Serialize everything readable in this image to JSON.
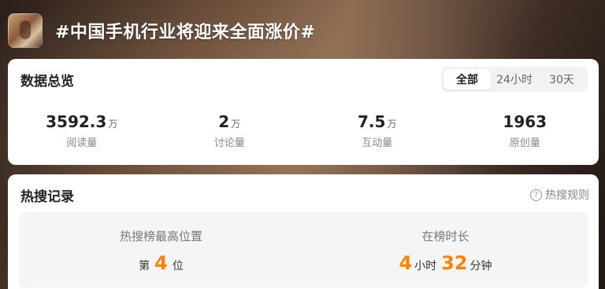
{
  "header": {
    "topic_title": "#中国手机行业将迎来全面涨价#"
  },
  "overview": {
    "title": "数据总览",
    "tabs": [
      {
        "label": "全部",
        "active": true
      },
      {
        "label": "24小时",
        "active": false
      },
      {
        "label": "30天",
        "active": false
      }
    ],
    "stats": [
      {
        "value": "3592.3",
        "unit": "万",
        "label": "阅读量"
      },
      {
        "value": "2",
        "unit": "万",
        "label": "讨论量"
      },
      {
        "value": "7.5",
        "unit": "万",
        "label": "互动量"
      },
      {
        "value": "1963",
        "unit": "",
        "label": "原创量"
      }
    ]
  },
  "hot_search": {
    "title": "热搜记录",
    "rules_label": "热搜规则",
    "highest_rank": {
      "label": "热搜榜最高位置",
      "prefix": "第",
      "value": "4",
      "suffix": "位"
    },
    "duration": {
      "label": "在榜时长",
      "hours": "4",
      "hours_unit": "小时",
      "minutes": "32",
      "minutes_unit": "分钟"
    }
  },
  "colors": {
    "accent": "#ff8200"
  }
}
